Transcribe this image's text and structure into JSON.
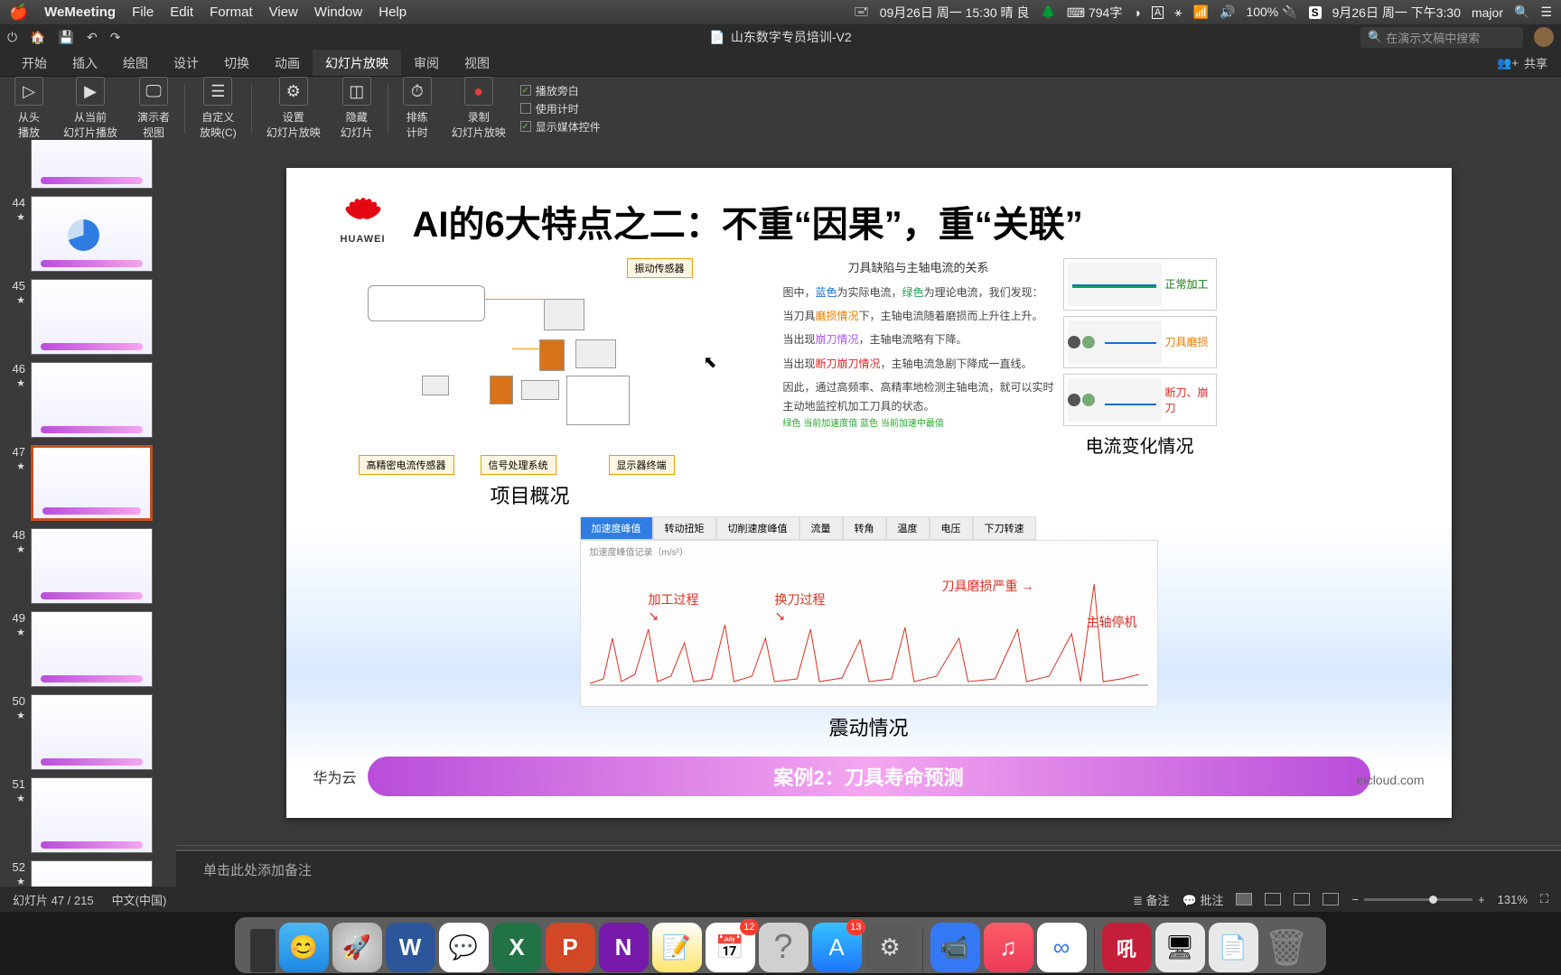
{
  "menubar": {
    "app": "WeMeeting",
    "items": [
      "File",
      "Edit",
      "Format",
      "View",
      "Window",
      "Help"
    ],
    "right": {
      "date_widget": "09月26日 周一 15:30 晴 良",
      "word_count": "794字",
      "battery": "100%",
      "clock": "9月26日 周一 下午3:30",
      "user": "major"
    }
  },
  "qat": {
    "doc_title": "山东数字专员培训-V2",
    "search_placeholder": "在演示文稿中搜索",
    "share": "共享"
  },
  "ribbon_tabs": [
    "开始",
    "插入",
    "绘图",
    "设计",
    "切换",
    "动画",
    "幻灯片放映",
    "审阅",
    "视图"
  ],
  "ribbon_active_index": 6,
  "ribbon": {
    "from_beginning": "从头\n播放",
    "from_current": "从当前\n幻灯片播放",
    "presenter_view": "演示者\n视图",
    "custom_show": "自定义\n放映(C)",
    "setup": "设置\n幻灯片放映",
    "hide": "隐藏\n幻灯片",
    "rehearse": "排练\n计时",
    "record": "录制\n幻灯片放映",
    "chk1": "播放旁白",
    "chk2": "使用计时",
    "chk3": "显示媒体控件"
  },
  "thumbs": [
    {
      "n": "44"
    },
    {
      "n": "45"
    },
    {
      "n": "46"
    },
    {
      "n": "47",
      "active": true
    },
    {
      "n": "48"
    },
    {
      "n": "49"
    },
    {
      "n": "50"
    },
    {
      "n": "51"
    },
    {
      "n": "52"
    }
  ],
  "slide": {
    "logo_text": "HUAWEI",
    "title": "AI的6大特点之二：不重“因果”，重“关联”",
    "left_label": "项目概况",
    "right_label": "电流变化情况",
    "bottom_label": "震动情况",
    "diag_tags": {
      "top": "振动传感器",
      "bl": "高精密电流传感器",
      "bm": "信号处理系统",
      "br": "显示器终端"
    },
    "para_title": "刀具缺陷与主轴电流的关系",
    "para1_a": "图中，",
    "para1_b": "蓝色",
    "para1_c": "为实际电流，",
    "para1_d": "绿色",
    "para1_e": "为理论电流，我们发现：",
    "para2_a": "当刀具",
    "para2_b": "磨损情况",
    "para2_c": "下，主轴电流随着磨损而上升往上升。",
    "para3_a": "当出现",
    "para3_b": "崩刀情况",
    "para3_c": "，主轴电流略有下降。",
    "para4_a": "当出现",
    "para4_b": "断刀崩刀情况",
    "para4_c": "，主轴电流急剧下降成一直线。",
    "para5": "因此，通过高频率、高精率地检测主轴电流，就可以实时主动地监控机加工刀具的状态。",
    "foot_colors": "绿色 当前加速度值  蓝色 当前加速中最值",
    "mini_labels": [
      "正常加工",
      "刀具磨损",
      "断刀、崩刀"
    ],
    "vib_tabs": [
      "加速度峰值",
      "转动扭矩",
      "切削速度峰值",
      "流量",
      "转角",
      "温度",
      "电压",
      "下刀转速"
    ],
    "vib_chart_title": "加速度峰值记录（m/s²）",
    "vib_ann": [
      "加工过程",
      "换刀过程",
      "刀具磨损严重",
      "主轴停机"
    ],
    "pill": "案例2：刀具寿命预测",
    "bottom_left": "华为云",
    "bottom_right": "eicloud.com"
  },
  "notes": {
    "placeholder": "单击此处添加备注"
  },
  "statusbar": {
    "slide": "幻灯片 47 / 215",
    "lang": "中文(中国)",
    "notes": "备注",
    "comments": "批注",
    "zoom": "131%"
  },
  "dock": {
    "items": [
      {
        "name": "finder",
        "bg": "#2aa3f4",
        "glyph": "🙂"
      },
      {
        "name": "launchpad",
        "bg": "#8e9196",
        "glyph": "🚀"
      },
      {
        "name": "word",
        "bg": "#2b579a",
        "glyph": "W"
      },
      {
        "name": "wechat",
        "bg": "#fff",
        "glyph": "💬"
      },
      {
        "name": "excel",
        "bg": "#217346",
        "glyph": "X"
      },
      {
        "name": "powerpoint",
        "bg": "#d24726",
        "glyph": "P"
      },
      {
        "name": "onenote",
        "bg": "#7719aa",
        "glyph": "N"
      },
      {
        "name": "notes",
        "bg": "#fff3a0",
        "glyph": "📝"
      },
      {
        "name": "calendar",
        "bg": "#fff",
        "glyph": "📅",
        "badge": "12"
      },
      {
        "name": "help",
        "bg": "#d0d0d0",
        "glyph": "?"
      },
      {
        "name": "appstore",
        "bg": "#1e90ff",
        "glyph": "A",
        "badge": "13"
      },
      {
        "name": "settings",
        "bg": "#5a5a5a",
        "glyph": "⚙"
      },
      {
        "name": "video",
        "bg": "#3478f6",
        "glyph": "📹"
      },
      {
        "name": "music",
        "bg": "#fc3c44",
        "glyph": "🎵"
      },
      {
        "name": "cloud",
        "bg": "#fff",
        "glyph": "☁"
      },
      {
        "name": "app-red",
        "bg": "#c41e3a",
        "glyph": "吼"
      },
      {
        "name": "wemeeting",
        "bg": "#e8e8e8",
        "glyph": "🖥"
      },
      {
        "name": "folder",
        "bg": "#e8e8e8",
        "glyph": "📄"
      },
      {
        "name": "trash",
        "bg": "#c0c0c0",
        "glyph": "🗑"
      }
    ]
  }
}
